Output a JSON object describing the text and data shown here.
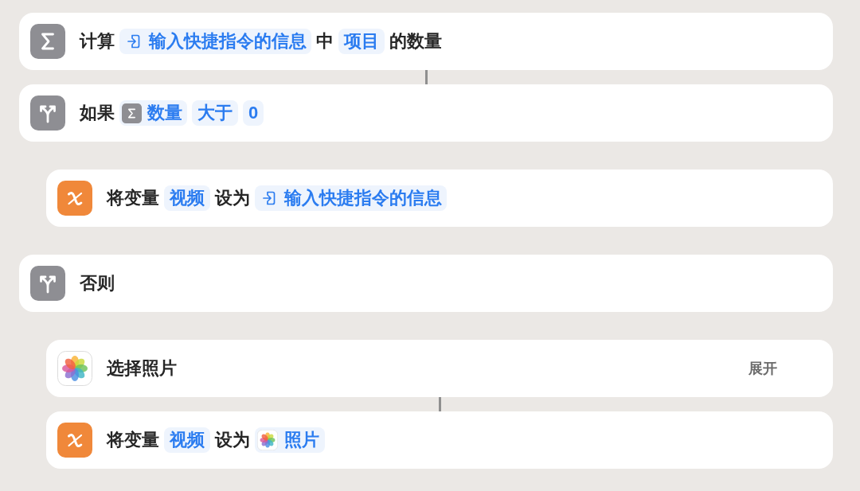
{
  "actions": [
    {
      "kind": "calculate",
      "linked": false,
      "parts": [
        {
          "kind": "text",
          "text": "计算"
        },
        {
          "kind": "input",
          "text": "输入快捷指令的信息"
        },
        {
          "kind": "text",
          "text": "中"
        },
        {
          "kind": "param",
          "text": "项目"
        },
        {
          "kind": "text",
          "text": "的数量"
        }
      ]
    },
    {
      "kind": "if",
      "linked": true,
      "parts": [
        {
          "kind": "text",
          "text": "如果"
        },
        {
          "kind": "calculation",
          "text": "数量"
        },
        {
          "kind": "param",
          "text": "大于"
        },
        {
          "kind": "param",
          "text": "0"
        }
      ],
      "children": [
        {
          "kind": "variable",
          "linked": false,
          "parts": [
            {
              "kind": "text",
              "text": "将变量"
            },
            {
              "kind": "param",
              "text": "视频"
            },
            {
              "kind": "text",
              "text": "设为"
            },
            {
              "kind": "input",
              "text": "输入快捷指令的信息"
            }
          ]
        }
      ]
    },
    {
      "kind": "otherwise",
      "linked": false,
      "parts": [
        {
          "kind": "text",
          "text": "否则"
        }
      ],
      "children": [
        {
          "kind": "photos",
          "linked": false,
          "parts": [
            {
              "kind": "text",
              "text": "选择照片"
            }
          ],
          "expand_label": "展开"
        },
        {
          "kind": "variable",
          "linked": true,
          "parts": [
            {
              "kind": "text",
              "text": "将变量"
            },
            {
              "kind": "param",
              "text": "视频"
            },
            {
              "kind": "text",
              "text": "设为"
            },
            {
              "kind": "photo",
              "text": "照片"
            }
          ]
        }
      ]
    }
  ]
}
